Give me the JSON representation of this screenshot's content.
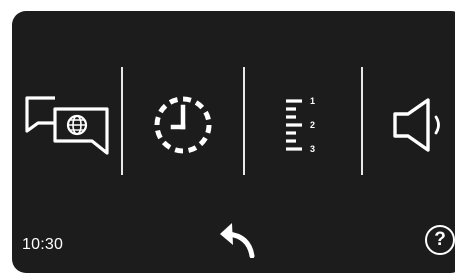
{
  "status": {
    "time": "10:30"
  },
  "menu": {
    "items": [
      {
        "icon": "language-icon"
      },
      {
        "icon": "clock-icon"
      },
      {
        "icon": "list-numbered-icon",
        "numbers": [
          "1",
          "2",
          "3"
        ]
      },
      {
        "icon": "speaker-icon"
      }
    ]
  },
  "footer": {
    "help_label": "?"
  },
  "colors": {
    "background": "#1c1c1c",
    "foreground": "#ffffff",
    "divider": "#e8e8e8"
  }
}
